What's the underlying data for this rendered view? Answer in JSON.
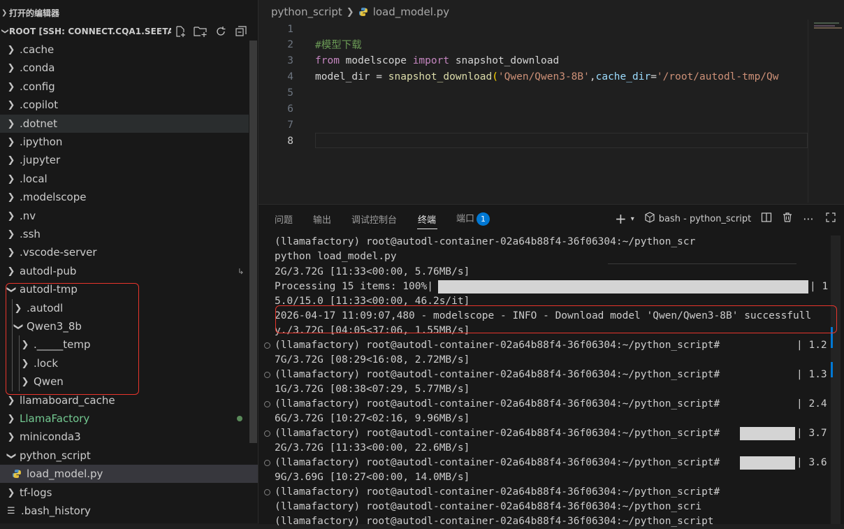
{
  "sidebar": {
    "open_editors_title": "打开的编辑器",
    "root_title": "ROOT [SSH: CONNECT.CQA1.SEETA...",
    "header_icons": [
      "new-file-icon",
      "new-folder-icon",
      "refresh-icon",
      "collapse-all-icon"
    ],
    "items": [
      {
        "label": ".cache"
      },
      {
        "label": ".conda"
      },
      {
        "label": ".config"
      },
      {
        "label": ".copilot"
      },
      {
        "label": ".dotnet"
      },
      {
        "label": ".ipython"
      },
      {
        "label": ".jupyter"
      },
      {
        "label": ".local"
      },
      {
        "label": ".modelscope"
      },
      {
        "label": ".nv"
      },
      {
        "label": ".ssh"
      },
      {
        "label": ".vscode-server"
      },
      {
        "label": "autodl-pub"
      },
      {
        "label": "autodl-tmp"
      },
      {
        "label": ".autodl"
      },
      {
        "label": "Qwen3_8b"
      },
      {
        "label": "._____temp"
      },
      {
        "label": ".lock"
      },
      {
        "label": "Qwen"
      },
      {
        "label": "llamaboard_cache"
      },
      {
        "label": "LlamaFactory"
      },
      {
        "label": "miniconda3"
      },
      {
        "label": "python_script"
      },
      {
        "label": "load_model.py"
      },
      {
        "label": "tf-logs"
      },
      {
        "label": ".bash_history"
      }
    ]
  },
  "editor": {
    "breadcrumb": {
      "folder": "python_script",
      "file": "load_model.py"
    },
    "line_numbers": [
      "1",
      "2",
      "3",
      "4",
      "5",
      "6",
      "7",
      "8"
    ],
    "line2": "#模型下载",
    "line3": {
      "kw_from": "from",
      "module": "modelscope",
      "kw_import": "import",
      "name": "snapshot_download"
    },
    "line4": {
      "var": "model_dir",
      "eq": " = ",
      "fn": "snapshot_download",
      "open": "(",
      "arg1": "'Qwen/Qwen3-8B'",
      "comma": ",",
      "param": "cache_dir",
      "eq2": "=",
      "arg2": "'/root/autodl-tmp/Qw"
    }
  },
  "panel": {
    "tabs": [
      "问题",
      "输出",
      "调试控制台",
      "终端",
      "端口"
    ],
    "active_tab": "终端",
    "ports_badge": "1",
    "terminal_name": "bash - python_script",
    "terminal_lines": [
      "(llamafactory) root@autodl-container-02a64b88f4-36f06304:~/python_scr",
      "python load_model.py",
      "2G/3.72G [11:33<00:00, 5.76MB/s]",
      "Processing 15 items: 100%|",
      "| 1",
      "5.0/15.0 [11:33<00:00, 46.2s/it]",
      "2026-04-17 11:09:07,480 - modelscope - INFO - Download model 'Qwen/Qwen3-8B' successfull",
      "y./3.72G [04:05<37:06, 1.55MB/s]",
      "(llamafactory) root@autodl-container-02a64b88f4-36f06304:~/python_script#",
      "| 1.2",
      "7G/3.72G [08:29<16:08, 2.72MB/s]",
      "(llamafactory) root@autodl-container-02a64b88f4-36f06304:~/python_script#",
      "| 1.3",
      "1G/3.72G [08:38<07:29, 5.77MB/s]",
      "(llamafactory) root@autodl-container-02a64b88f4-36f06304:~/python_script#",
      "| 2.4",
      "6G/3.72G [10:27<02:16, 9.96MB/s]",
      "(llamafactory) root@autodl-container-02a64b88f4-36f06304:~/python_script#",
      "| 3.7",
      "2G/3.72G [11:33<00:00, 22.6MB/s]",
      "(llamafactory) root@autodl-container-02a64b88f4-36f06304:~/python_script#",
      "| 3.6",
      "9G/3.69G [10:27<00:00, 14.0MB/s]",
      "(llamafactory) root@autodl-container-02a64b88f4-36f06304:~/python_script#",
      "(llamafactory) root@autodl-container-02a64b88f4-36f06304:~/python_scri",
      "(llamafactory) root@autodl-container-02a64b88f4-36f06304:~/python_script"
    ]
  },
  "colors": {
    "highlight_box": "#e8352c",
    "accent": "#0078d4",
    "git_untracked": "#73c991"
  }
}
